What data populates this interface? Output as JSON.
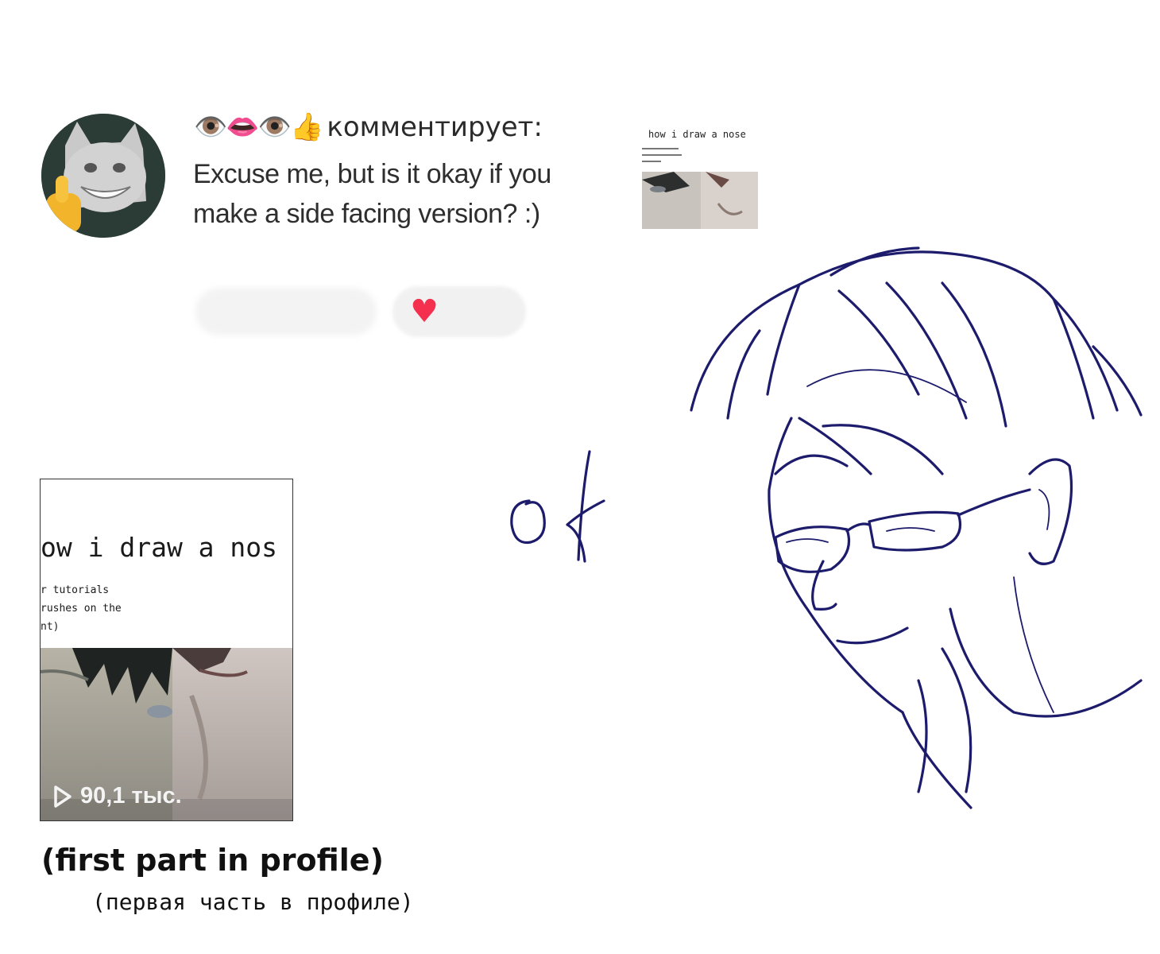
{
  "comment": {
    "emoji_prefix": "👁️👄👁️👍",
    "action": "комментирует:",
    "text": "Excuse me, but is it okay if you make a side facing version? :)"
  },
  "reference_thumbnail": {
    "title": "how i draw a nose"
  },
  "video_card": {
    "title": "ow i draw a nos",
    "lines": [
      "r tutorials",
      "rushes on the",
      "nt)"
    ],
    "views": "90,1 тыс."
  },
  "reply": {
    "handwritten": "ok"
  },
  "caption": {
    "english": "(first part in profile)",
    "russian": "(первая часть в профиле)"
  },
  "colors": {
    "ink": "#1d1b6b",
    "heart": "#f5304f"
  },
  "icons": [
    "avatar-cat-thumbs-up",
    "heart-icon",
    "play-icon"
  ]
}
